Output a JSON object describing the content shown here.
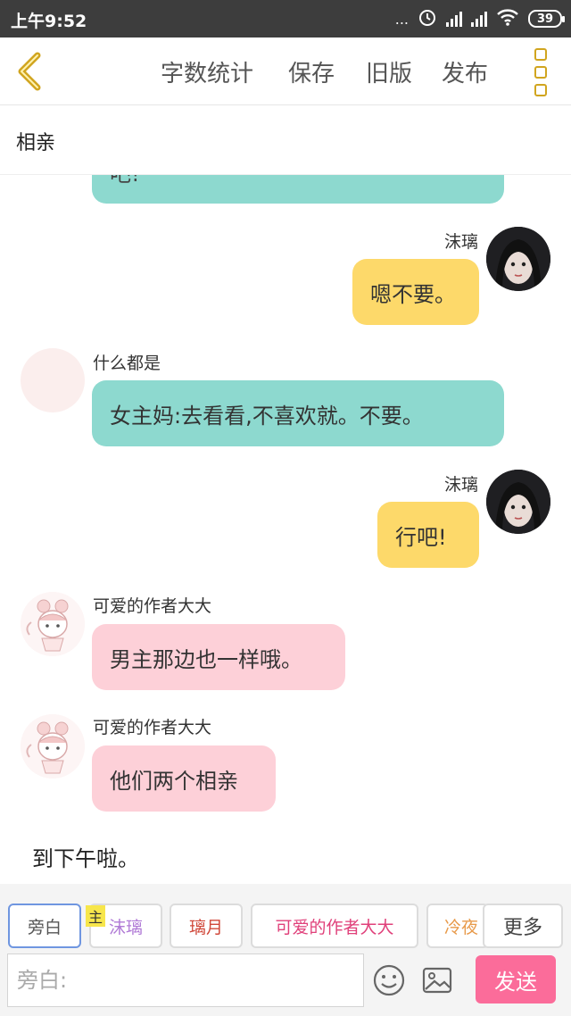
{
  "status_bar": {
    "time": "上午9:52",
    "more": "...",
    "battery": "39"
  },
  "toolbar": {
    "word_count": "字数统计",
    "save": "保存",
    "old_version": "旧版",
    "publish": "发布"
  },
  "story_title": "相亲",
  "messages": [
    {
      "sender": "",
      "text": "吧!",
      "side": "left",
      "color": "teal"
    },
    {
      "sender": "沫璃",
      "text": "嗯不要。",
      "side": "right",
      "color": "yellow"
    },
    {
      "sender": "什么都是",
      "text": "女主妈:去看看,不喜欢就。不要。",
      "side": "left",
      "color": "teal"
    },
    {
      "sender": "沫璃",
      "text": "行吧!",
      "side": "right",
      "color": "yellow"
    },
    {
      "sender": "可爱的作者大大",
      "text": "男主那边也一样哦。",
      "side": "left",
      "color": "pink"
    },
    {
      "sender": "可爱的作者大大",
      "text": "他们两个相亲",
      "side": "left",
      "color": "pink"
    }
  ],
  "narration": "到下午啦。",
  "roles": [
    {
      "label": "旁白",
      "color": "#555555",
      "active": true
    },
    {
      "label": "沫璃",
      "color": "#b07ad6",
      "active": false
    },
    {
      "label": "璃月",
      "color": "#d0483a",
      "active": false
    },
    {
      "label": "可爱的作者大大",
      "color": "#e0407a",
      "active": false
    },
    {
      "label": "冷夜",
      "color": "#e89a4a",
      "active": false
    }
  ],
  "lead_badge": "主",
  "more_label": "更多",
  "input_placeholder": "旁白:",
  "send_label": "发送",
  "colors": {
    "teal_bubble": "#8dd9cf",
    "yellow_bubble": "#fdd96a",
    "pink_bubble": "#fdd0d8",
    "accent_gold": "#d1a51f",
    "send_pink": "#fb6c9a"
  }
}
